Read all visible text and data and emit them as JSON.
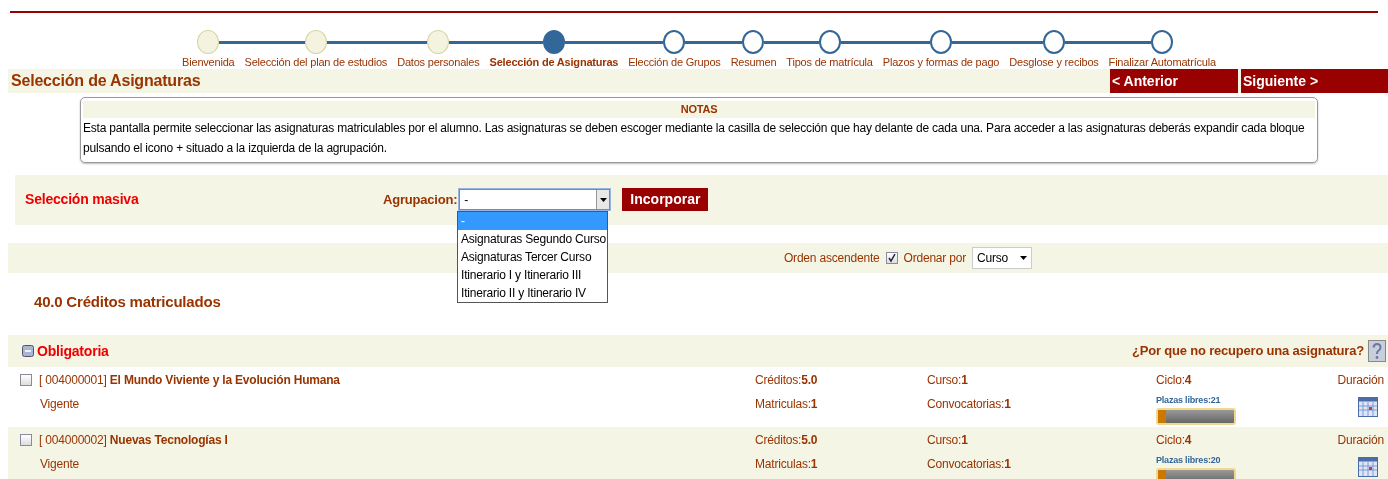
{
  "steps": [
    {
      "label": "Bienvenida",
      "kind": "done"
    },
    {
      "label": "Selección del plan de estudios",
      "kind": "done"
    },
    {
      "label": "Datos personales",
      "kind": "done"
    },
    {
      "label": "Selección de Asignaturas",
      "kind": "current"
    },
    {
      "label": "Elección de Grupos",
      "kind": "pending"
    },
    {
      "label": "Resumen",
      "kind": "pending"
    },
    {
      "label": "Tipos de matrícula",
      "kind": "pending"
    },
    {
      "label": "Plazos y formas de pago",
      "kind": "pending"
    },
    {
      "label": "Desglose y recibos",
      "kind": "pending"
    },
    {
      "label": "Finalizar Automatrícula",
      "kind": "pending"
    }
  ],
  "header": {
    "title": "Selección de Asignaturas",
    "prev_button": "< Anterior",
    "next_button": "Siguiente >"
  },
  "notes": {
    "title": "NOTAS",
    "text": "Esta pantalla permite seleccionar las asignaturas matriculables por el alumno. Las asignaturas se deben escoger mediante la casilla de selección que hay delante de cada una. Para acceder a las asignaturas deberás expandir cada bloque pulsando el icono + situado a la izquierda de la agrupación."
  },
  "mass_selection": {
    "title": "Selección masiva",
    "grouping_label": "Agrupacion:",
    "grouping_value": "-",
    "expanded": true,
    "options": [
      {
        "label": "-",
        "selected": true
      },
      {
        "label": "Asignaturas Segundo Curso",
        "selected": false
      },
      {
        "label": "Asignaturas Tercer Curso",
        "selected": false
      },
      {
        "label": "Itinerario I y Itinerario III",
        "selected": false
      },
      {
        "label": "Itinerario II y Itinerario IV",
        "selected": false
      }
    ],
    "button": "Incorporar"
  },
  "order": {
    "ascending_label": "Orden ascendente",
    "ascending_checked": true,
    "sort_label": "Ordenar por",
    "sort_value": "Curso"
  },
  "credits": "40.0 Créditos matriculados",
  "group": {
    "title": "Obligatoria",
    "expanded": true,
    "help_link": "¿Por que no recupero una asignatura?"
  },
  "subjects": [
    {
      "checked": false,
      "code": "[ 004000001]",
      "name": "El Mundo Viviente y la Evolución Humana",
      "status": "Vigente",
      "credits": "Créditos:**5.0**",
      "course": "Curso:**1**",
      "cycle": "Ciclo:**4**",
      "duration": "Duración",
      "enrollments": "Matriculas:**1**",
      "calls": "Convocatorias:**1**",
      "places": "Plazas libres:21",
      "level": 0.1
    },
    {
      "checked": false,
      "code": "[ 004000002]",
      "name": "Nuevas Tecnologías I",
      "status": "Vigente",
      "credits": "Créditos:**5.0**",
      "course": "Curso:**1**",
      "cycle": "Ciclo:**4**",
      "duration": "Duración",
      "enrollments": "Matriculas:**1**",
      "calls": "Convocatorias:**1**",
      "places": "Plazas libres:20",
      "level": 0.1
    }
  ]
}
